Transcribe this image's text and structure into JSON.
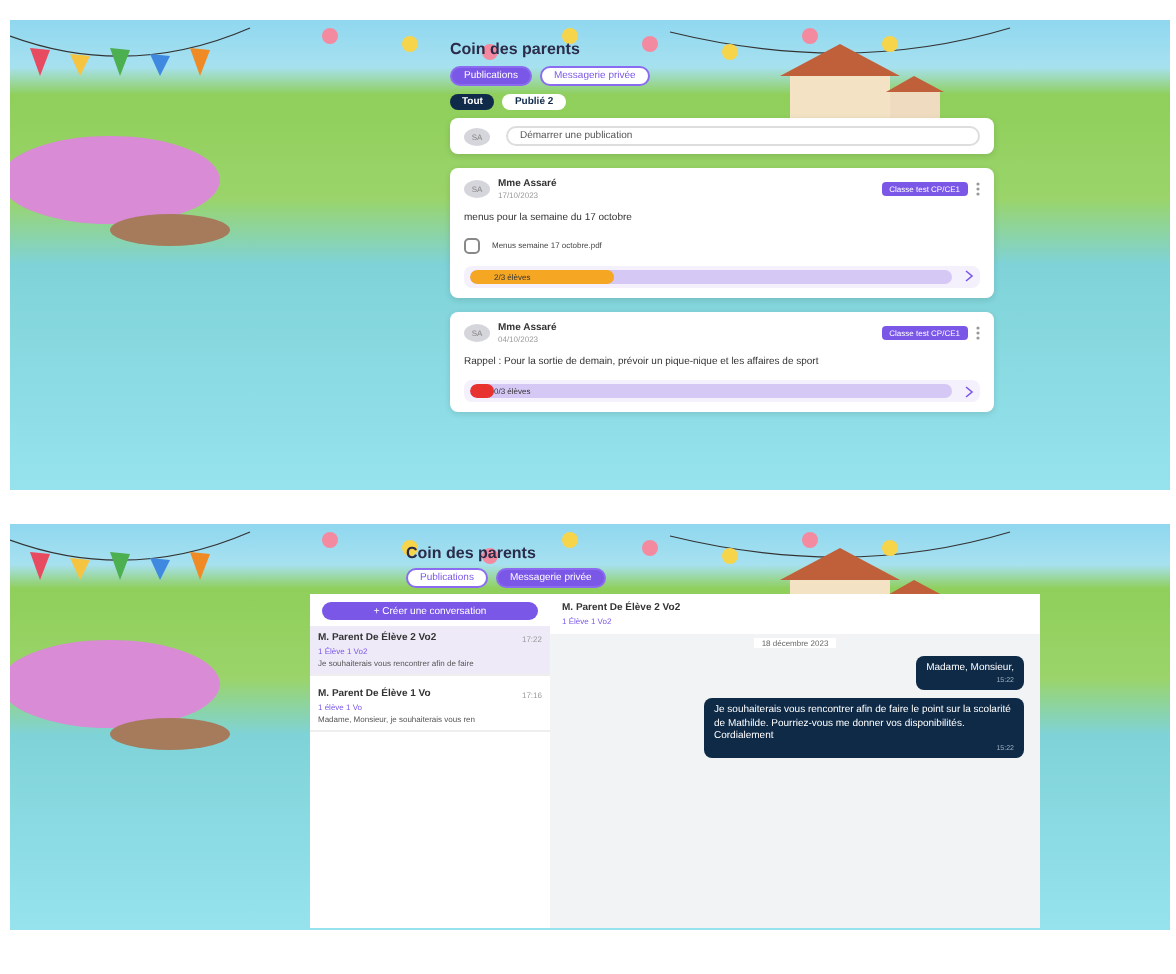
{
  "publications_view": {
    "title": "Coin des parents",
    "tabs": [
      {
        "label": "Publications",
        "selected": true
      },
      {
        "label": "Messagerie privée",
        "selected": false
      }
    ],
    "filters": [
      {
        "label": "Tout",
        "selected": true
      },
      {
        "label": "Publié",
        "count": "2",
        "selected": false
      }
    ],
    "composer": {
      "avatar": "SA",
      "placeholder": "Démarrer une publication"
    },
    "posts": [
      {
        "avatar": "SA",
        "author": "Mme Assaré",
        "date": "17/10/2023",
        "badge": "Classe test CP/CE1",
        "text": "menus pour la semaine du 17 octobre",
        "attachment": "Menus semaine 17 octobre.pdf",
        "progress": {
          "label": "2/3 élèves",
          "level": 0.3,
          "color": "#f5a623"
        }
      },
      {
        "avatar": "SA",
        "author": "Mme Assaré",
        "date": "04/10/2023",
        "badge": "Classe test CP/CE1",
        "text": "Rappel : Pour la sortie de demain, prévoir un pique-nique et les affaires de sport",
        "progress": {
          "label": "0/3 élèves",
          "level": 0.05,
          "color": "#e8322f"
        }
      }
    ]
  },
  "messages_view": {
    "title": "Coin des parents",
    "tabs": [
      {
        "label": "Publications",
        "selected": false
      },
      {
        "label": "Messagerie privée",
        "selected": true
      }
    ],
    "new_conversation": "+ Créer une conversation",
    "conversations": [
      {
        "name": "M. Parent De Élève 2 Vo2",
        "time": "17:22",
        "student": "1 Élève 1 Vo2",
        "preview": "Je souhaiterais vous rencontrer afin de faire",
        "selected": true
      },
      {
        "name": "M. Parent De Élève 1 Vo",
        "time": "17:16",
        "student": "1 élève 1 Vo",
        "preview": "Madame, Monsieur, je souhaiterais vous ren",
        "selected": false
      }
    ],
    "chat": {
      "name": "M. Parent De Élève 2 Vo2",
      "student": "1 Élève 1 Vo2",
      "date": "18 décembre 2023",
      "messages": [
        {
          "text": "Madame, Monsieur,",
          "time": "15:22"
        },
        {
          "text": "Je souhaiterais vous rencontrer afin de faire le point sur la scolarité de Mathilde. Pourriez-vous me donner vos disponibilités.\nCordialement",
          "time": "15:22"
        }
      ]
    }
  }
}
